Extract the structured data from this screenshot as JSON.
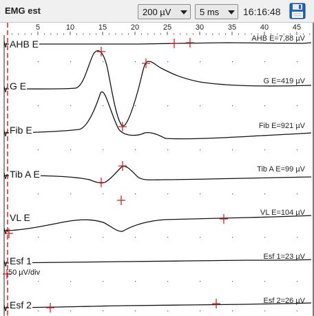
{
  "toolbar": {
    "title": "EMG est",
    "sensitivity": "200 µV",
    "sweep": "5 ms",
    "time": "16:16:48",
    "save_icon": "floppy-disk-icon"
  },
  "axis": {
    "ticks": [
      "5",
      "10",
      "15",
      "20",
      "25",
      "30",
      "35",
      "40",
      "45"
    ]
  },
  "channels": [
    {
      "label": "AHB E",
      "value": "AHB E=7,88 µV"
    },
    {
      "label": "G E",
      "value": "G E=419 µV"
    },
    {
      "label": "Fib E",
      "value": "Fib E=921 µV"
    },
    {
      "label": "Tib A E",
      "value": "Tib A E=99 µV"
    },
    {
      "label": "VL E",
      "value": "VL E=104 µV"
    },
    {
      "label": "Esf 1",
      "value": "Esf 1=23 µV"
    },
    {
      "label": "Esf 2",
      "value": "Esf 2=26 µV"
    }
  ],
  "scale_label": "50 µV/div",
  "colors": {
    "cursor": "#e02020",
    "marker": "#d01010",
    "trace": "#111111",
    "grid_dot": "#555555"
  }
}
